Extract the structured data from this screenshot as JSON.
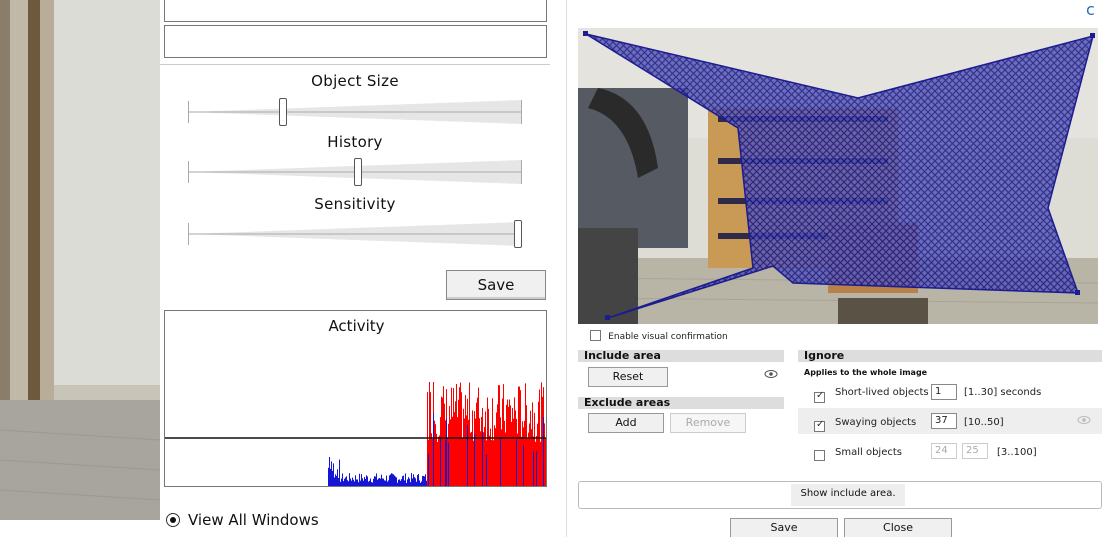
{
  "left_panel": {
    "sliders": [
      {
        "label": "Object Size",
        "value": 0.28
      },
      {
        "label": "History",
        "value": 0.51
      },
      {
        "label": "Sensitivity",
        "value": 1.0
      }
    ],
    "save_label": "Save",
    "activity": {
      "title": "Activity",
      "threshold": 0.31
    },
    "view_all_label": "View All Windows"
  },
  "right_panel": {
    "enable_visual_confirmation": {
      "label": "Enable visual confirmation",
      "checked": false
    },
    "include_area": {
      "title": "Include area",
      "reset_label": "Reset"
    },
    "exclude_areas": {
      "title": "Exclude areas",
      "add_label": "Add",
      "remove_label": "Remove"
    },
    "ignore": {
      "title": "Ignore",
      "subtitle": "Applies to the whole image",
      "short_lived": {
        "label": "Short-lived objects",
        "checked": true,
        "value": "1",
        "range": "[1..30] seconds"
      },
      "swaying": {
        "label": "Swaying objects",
        "checked": true,
        "value": "37",
        "range": "[10..50]"
      },
      "small": {
        "label": "Small objects",
        "checked": false,
        "width": "24",
        "height": "25",
        "range": "[3..100]"
      }
    },
    "show_include_area_label": "Show include area.",
    "save_label": "Save",
    "close_label": "Close"
  },
  "colors": {
    "overlay": "#1a1a99",
    "activity_low": "#1515d6",
    "activity_high": "#ff0000",
    "section_header": "#dddddd"
  }
}
